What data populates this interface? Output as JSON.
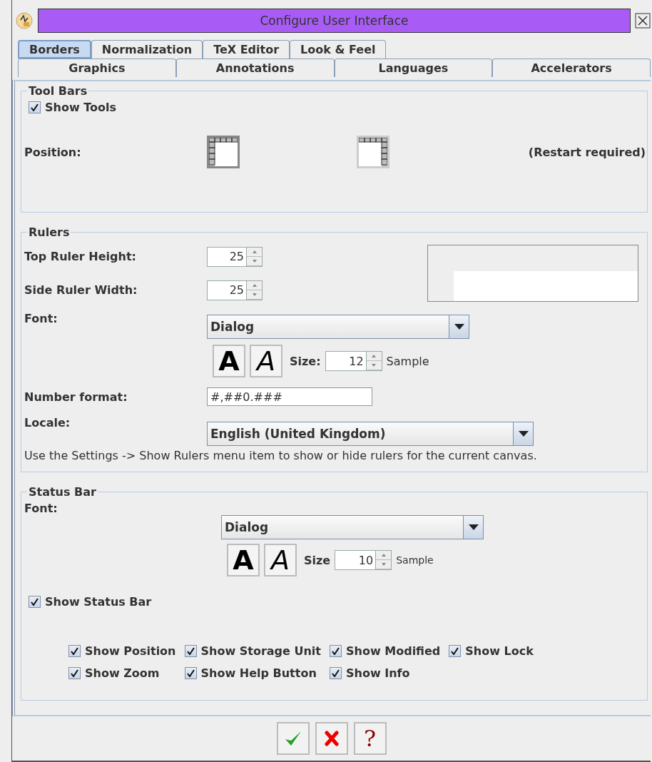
{
  "window": {
    "title": "Configure User Interface"
  },
  "tab_rows": [
    [
      {
        "label": "Borders",
        "selected": true
      },
      {
        "label": "Normalization",
        "selected": false
      },
      {
        "label": "TeX Editor",
        "selected": false
      },
      {
        "label": "Look & Feel",
        "selected": false
      }
    ],
    [
      {
        "label": "Graphics",
        "selected": false
      },
      {
        "label": "Annotations",
        "selected": false
      },
      {
        "label": "Languages",
        "selected": false
      },
      {
        "label": "Accelerators",
        "selected": false
      }
    ]
  ],
  "tool_bars": {
    "title": "Tool Bars",
    "show_tools": {
      "label": "Show Tools",
      "checked": true
    },
    "position_label": "Position:",
    "positions": [
      {
        "kind": "left",
        "selected": true
      },
      {
        "kind": "right",
        "selected": false
      }
    ],
    "note": "(Restart required)"
  },
  "rulers": {
    "title": "Rulers",
    "top_height": {
      "label": "Top Ruler Height:",
      "value": "25"
    },
    "side_width": {
      "label": "Side Ruler Width:",
      "value": "25"
    },
    "font_label": "Font:",
    "font": "Dialog",
    "bold_button": "A",
    "italic_button": "A",
    "size_label": "Size:",
    "size": "12",
    "sample": "Sample",
    "number_format_label": "Number format:",
    "number_format": "#,##0.###",
    "locale_label": "Locale:",
    "locale": "English (United Kingdom)",
    "hint": "Use the Settings -> Show Rulers menu item to show or hide rulers for the current canvas."
  },
  "status_bar": {
    "title": "Status Bar",
    "font_label": "Font:",
    "font": "Dialog",
    "bold_button": "A",
    "italic_button": "A",
    "size_label": "Size",
    "size": "10",
    "sample": "Sample",
    "show_status_bar": {
      "label": "Show Status Bar",
      "checked": true
    },
    "options": [
      {
        "label": "Show Position",
        "checked": true
      },
      {
        "label": "Show Storage Unit",
        "checked": true
      },
      {
        "label": "Show Modified",
        "checked": true
      },
      {
        "label": "Show Lock",
        "checked": true
      },
      {
        "label": "Show Zoom",
        "checked": true
      },
      {
        "label": "Show Help Button",
        "checked": true
      },
      {
        "label": "Show Info",
        "checked": true
      }
    ]
  },
  "buttons": [
    {
      "kind": "ok"
    },
    {
      "kind": "cancel"
    },
    {
      "kind": "help",
      "label": "?"
    }
  ]
}
